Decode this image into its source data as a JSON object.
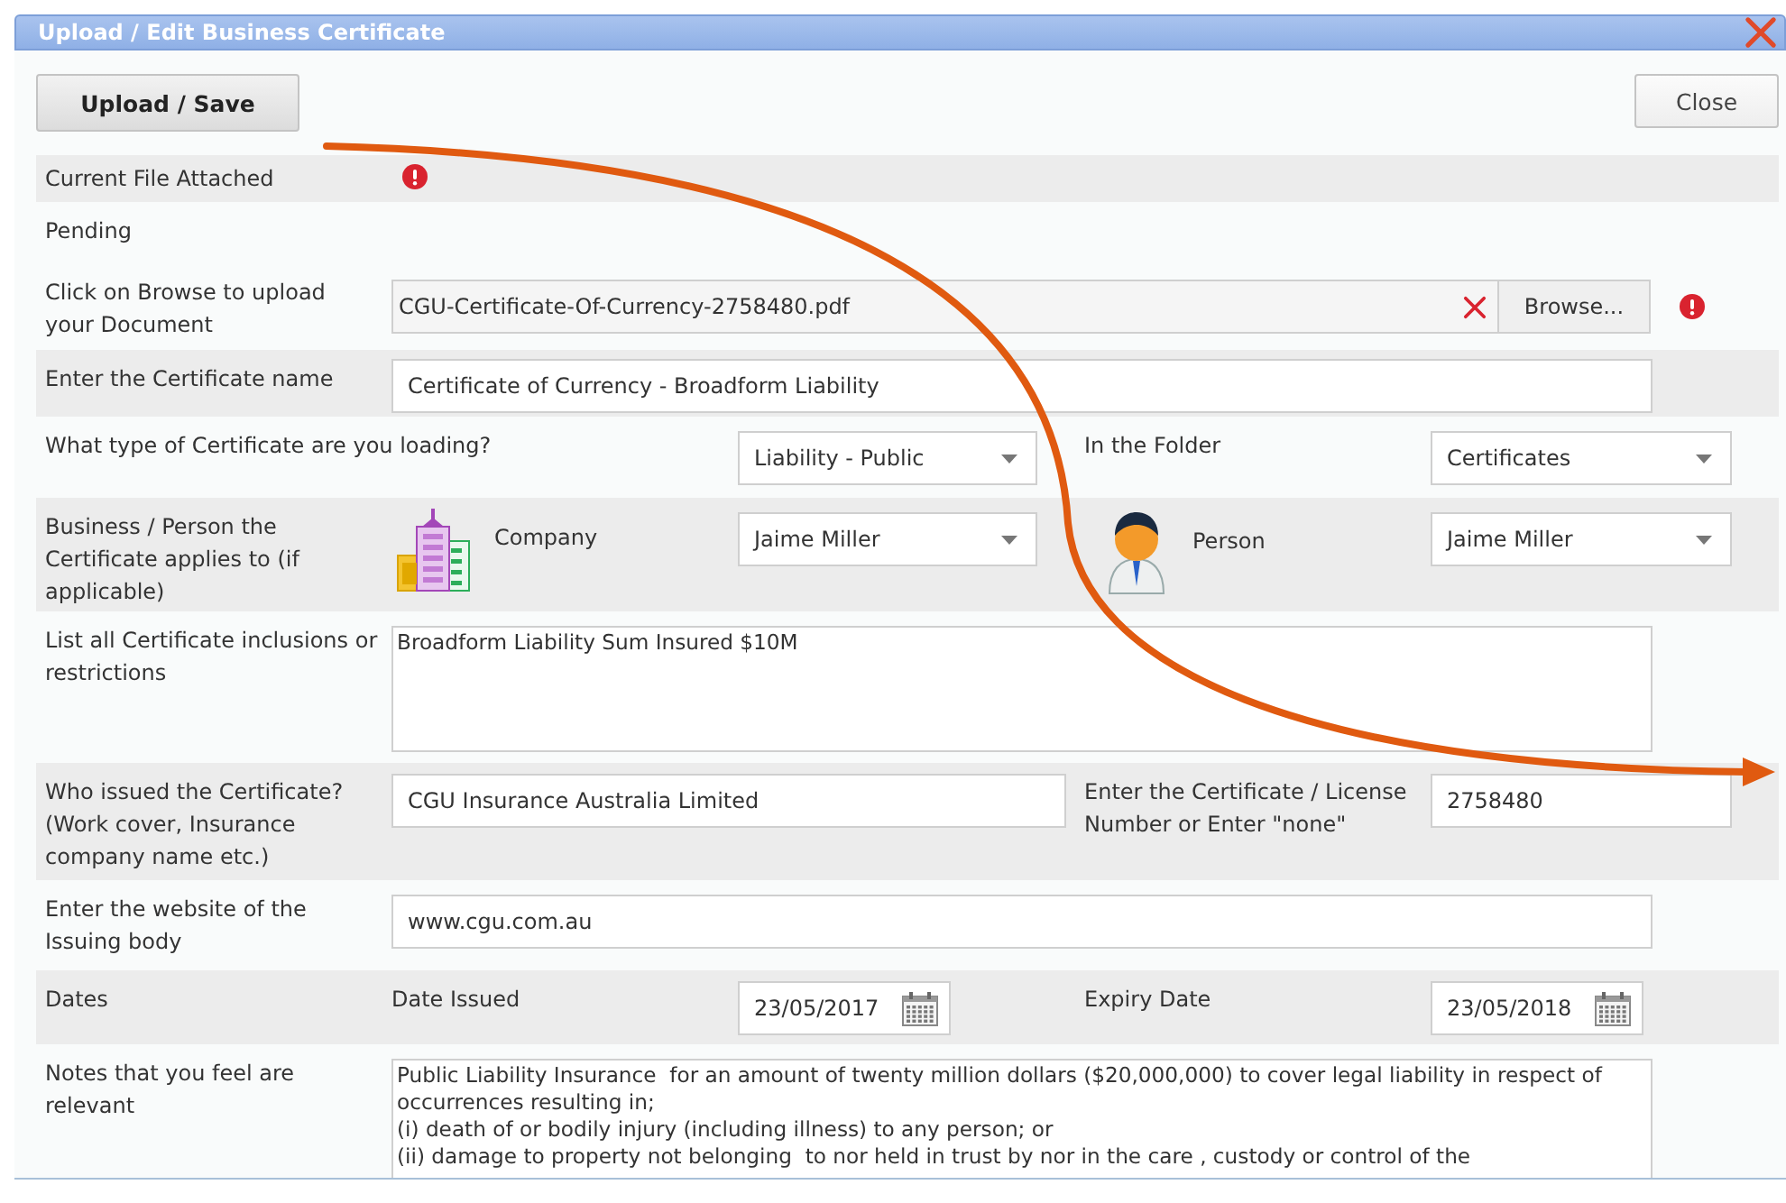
{
  "dialog": {
    "title": "Upload / Edit Business Certificate"
  },
  "buttons": [
    {
      "label": "Upload / Save",
      "kind": "primary"
    },
    {
      "label": "Close",
      "kind": "secondary"
    }
  ],
  "rows": [
    {
      "kind": "status",
      "label": "Current File Attached",
      "error": true,
      "shaded": true
    },
    {
      "kind": "note",
      "label": "Pending",
      "shaded": false
    },
    {
      "kind": "file",
      "label": "Click on Browse to upload your Document",
      "value": "CGU-Certificate-Of-Currency-2758480.pdf",
      "button": "Browse...",
      "error": true,
      "shaded": false
    },
    {
      "kind": "text",
      "label": "Enter the Certificate name",
      "value": "Certificate of Currency - Broadform Liability",
      "shaded": true
    },
    {
      "kind": "pair-select",
      "label": "What type of Certificate are you loading?",
      "value": "Liability - Public",
      "label2": "In the Folder",
      "value2": "Certificates",
      "shaded": false
    },
    {
      "kind": "entity",
      "label": "Business / Person the Certificate applies to (if applicable)",
      "company_label": "Company",
      "company": "Jaime Miller",
      "person_label": "Person",
      "person": "Jaime Miller",
      "shaded": true
    },
    {
      "kind": "textarea",
      "label": "List all Certificate inclusions or restrictions",
      "value": "Broadform Liability Sum Insured $10M",
      "shaded": false
    },
    {
      "kind": "pair-text",
      "label": "Who issued the Certificate? (Work cover, Insurance company name etc.)",
      "value": "CGU Insurance Australia Limited",
      "label2": "Enter the Certificate / License Number or Enter \"none\"",
      "value2": "2758480",
      "shaded": true
    },
    {
      "kind": "text",
      "label": "Enter the website of the Issuing body",
      "value": "www.cgu.com.au",
      "shaded": false
    },
    {
      "kind": "dates",
      "label": "Dates",
      "label1": "Date Issued",
      "value": "23/05/2017",
      "label2": "Expiry Date",
      "value2": "23/05/2018",
      "shaded": true
    },
    {
      "kind": "notes",
      "label": "Notes that you feel are relevant",
      "value": "Public Liability Insurance  for an amount of twenty million dollars ($20,000,000) to cover legal liability in respect of occurrences resulting in;\n(i) death of or bodily injury (including illness) to any person; or\n(ii) damage to property not belonging  to nor held in trust by nor in the care , custody or control of the",
      "shaded": false
    }
  ]
}
